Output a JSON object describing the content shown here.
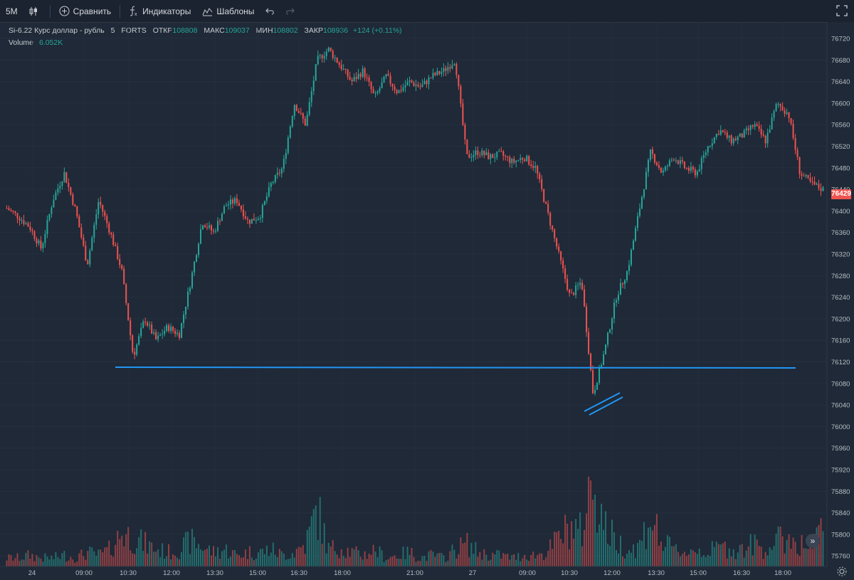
{
  "toolbar": {
    "timeframe": "5M",
    "compare_label": "Сравнить",
    "indicators_label": "Индикаторы",
    "templates_label": "Шаблоны"
  },
  "legend": {
    "symbol": "Si-6.22 Курс доллар - рубль",
    "interval": "5",
    "exchange": "FORTS",
    "open_label": "ОТКР",
    "open": "108808",
    "high_label": "МАКС",
    "high": "109037",
    "low_label": "МИН",
    "low": "108802",
    "close_label": "ЗАКР",
    "close": "108936",
    "change": "+124 (+0.11%)",
    "volume_label": "Volume",
    "volume": "6.052K"
  },
  "last_price": "76429",
  "colors": {
    "background": "#1f2937",
    "up": "#26a69a",
    "down": "#ef5350",
    "line": "#2196f3"
  },
  "chart_data": {
    "type": "candlestick",
    "y_ticks": [
      76720,
      76680,
      76640,
      76600,
      76560,
      76520,
      76480,
      76440,
      76400,
      76360,
      76320,
      76280,
      76240,
      76200,
      76160,
      76120,
      76080,
      76040,
      76000,
      75960,
      75920,
      75880,
      75840,
      75800,
      75760
    ],
    "x_ticks": [
      "24",
      "09:00",
      "10:30",
      "12:00",
      "13:30",
      "15:00",
      "16:30",
      "18:00",
      "21:00",
      "27",
      "09:00",
      "10:30",
      "12:00",
      "13:30",
      "15:00",
      "16:30",
      "18:00"
    ],
    "price_path": [
      76405,
      76390,
      76370,
      76330,
      76420,
      76470,
      76400,
      76300,
      76420,
      76360,
      76290,
      76130,
      76200,
      76160,
      76185,
      76170,
      76270,
      76380,
      76360,
      76410,
      76420,
      76380,
      76390,
      76450,
      76480,
      76600,
      76560,
      76680,
      76700,
      76670,
      76640,
      76660,
      76610,
      76650,
      76620,
      76640,
      76630,
      76650,
      76660,
      76680,
      76500,
      76510,
      76500,
      76505,
      76490,
      76500,
      76480,
      76400,
      76320,
      76240,
      76270,
      76060,
      76140,
      76240,
      76290,
      76400,
      76510,
      76470,
      76500,
      76480,
      76470,
      76520,
      76550,
      76530,
      76540,
      76560,
      76530,
      76600,
      76580,
      76470,
      76450,
      76440
    ],
    "volume_path": [
      3,
      3,
      4,
      3,
      3,
      4,
      3,
      5,
      4,
      6,
      12,
      10,
      8,
      6,
      5,
      6,
      9,
      7,
      5,
      6,
      4,
      5,
      5,
      6,
      4,
      5,
      8,
      20,
      6,
      7,
      5,
      4,
      6,
      3,
      4,
      5,
      3,
      4,
      3,
      6,
      8,
      5,
      4,
      4,
      3,
      4,
      4,
      5,
      10,
      14,
      12,
      32,
      14,
      9,
      6,
      7,
      18,
      8,
      6,
      5,
      6,
      5,
      7,
      6,
      6,
      8,
      6,
      9,
      10,
      8,
      6,
      14
    ],
    "support_level": 76110,
    "ylim": [
      75740,
      76740
    ]
  }
}
